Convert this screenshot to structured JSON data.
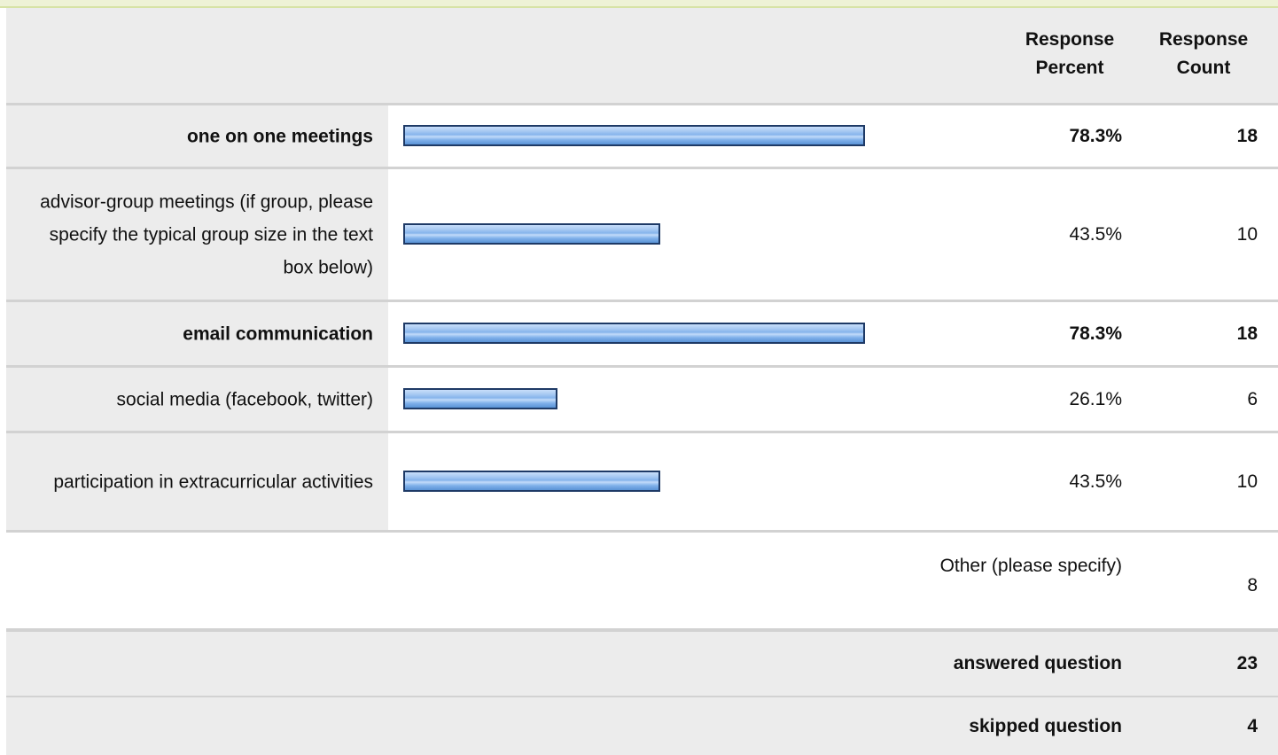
{
  "header": {
    "response_percent": "Response\nPercent",
    "response_count": "Response\nCount"
  },
  "rows": [
    {
      "label": "one on one meetings",
      "percent": "78.3%",
      "count": "18",
      "fraction": 0.783,
      "emphasis": true
    },
    {
      "label": "advisor-group meetings (if group, please specify the typical group size in the text box below)",
      "percent": "43.5%",
      "count": "10",
      "fraction": 0.435,
      "emphasis": false
    },
    {
      "label": "email communication",
      "percent": "78.3%",
      "count": "18",
      "fraction": 0.783,
      "emphasis": true
    },
    {
      "label": "social media (facebook, twitter)",
      "percent": "26.1%",
      "count": "6",
      "fraction": 0.261,
      "emphasis": false
    },
    {
      "label": "participation in extracurricular activities",
      "percent": "43.5%",
      "count": "10",
      "fraction": 0.435,
      "emphasis": false
    }
  ],
  "other": {
    "label": "Other (please specify)",
    "count": "8"
  },
  "summary": {
    "answered_label": "answered question",
    "answered_count": "23",
    "skipped_label": "skipped question",
    "skipped_count": "4"
  },
  "colors": {
    "bar_fill": "#86b4ec",
    "bar_border": "#1e3a66",
    "row_label_bg": "#ececec",
    "top_accent": "#eef2d6"
  }
}
